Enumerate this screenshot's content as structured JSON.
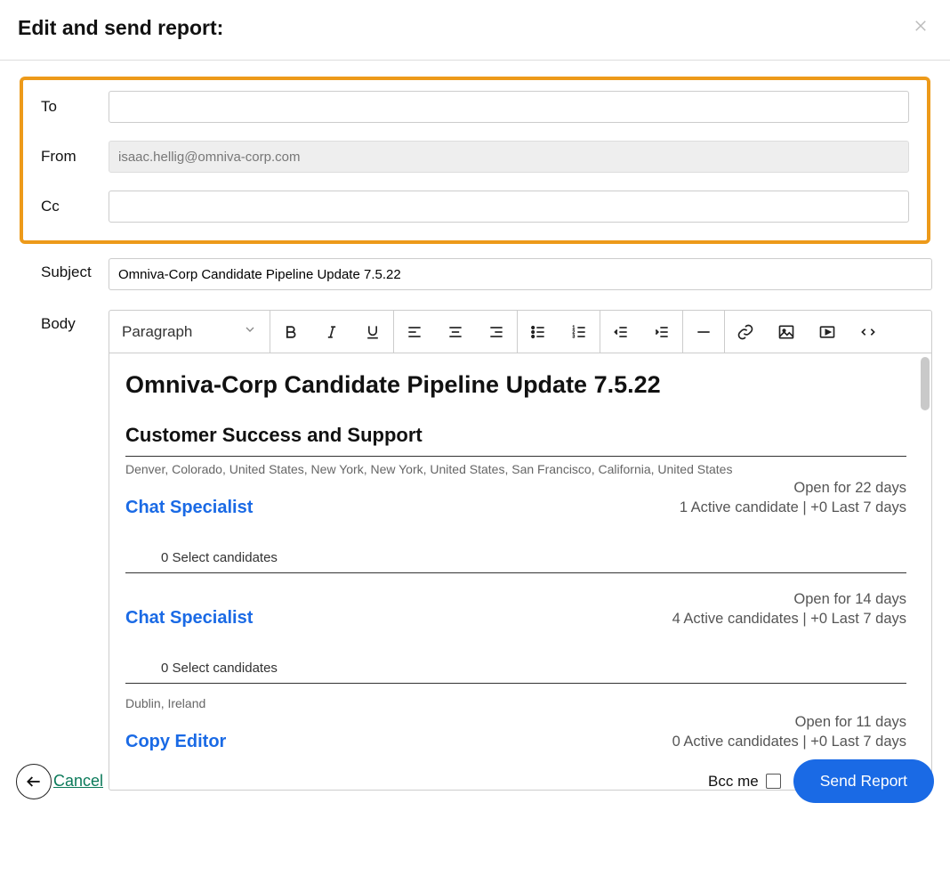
{
  "header": {
    "title": "Edit and send report:"
  },
  "fields": {
    "to_label": "To",
    "to_value": "",
    "from_label": "From",
    "from_value": "isaac.hellig@omniva-corp.com",
    "cc_label": "Cc",
    "cc_value": "",
    "subject_label": "Subject",
    "subject_value": "Omniva-Corp Candidate Pipeline Update 7.5.22",
    "body_label": "Body"
  },
  "toolbar": {
    "paragraph_label": "Paragraph"
  },
  "body": {
    "title": "Omniva-Corp Candidate Pipeline Update 7.5.22",
    "section": "Customer Success and Support",
    "locations1": "Denver, Colorado, United States, New York, New York, United States, San Francisco, California, United States",
    "jobs": [
      {
        "title": "Chat Specialist",
        "open": "Open for 22 days",
        "active": "1 Active candidate | +0 Last 7 days",
        "sub": "0 Select candidates"
      },
      {
        "title": "Chat Specialist",
        "open": "Open for 14 days",
        "active": "4 Active candidates | +0 Last 7 days",
        "sub": "0 Select candidates"
      },
      {
        "title": "Copy Editor",
        "open": "Open for 11 days",
        "active": "0 Active candidates | +0 Last 7 days",
        "loc": "Dublin, Ireland"
      }
    ]
  },
  "footer": {
    "cancel": "Cancel",
    "bcc": "Bcc me",
    "send": "Send Report"
  }
}
